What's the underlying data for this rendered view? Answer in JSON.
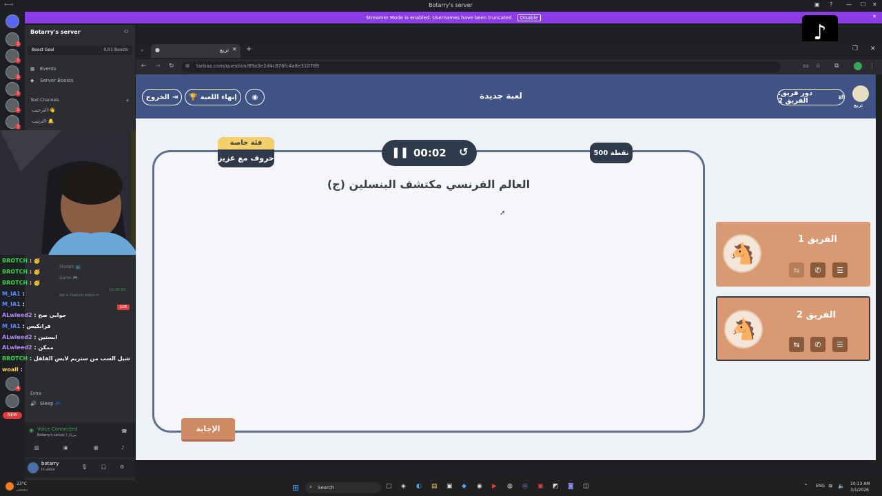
{
  "titlebar": {
    "title": "Botarry's server"
  },
  "banner": {
    "text": "Streamer Mode is enabled. Usernames have been truncated.",
    "button": "Disable"
  },
  "server_panel": {
    "server_name": "Botarry's server",
    "boost_goal": "Boost Goal",
    "boost_count": "0/31 Boosts",
    "items": [
      "Events",
      "Server Boosts"
    ],
    "text_channels_header": "Text Channels",
    "text_channels": [
      "الترحيب-👋",
      "الترتيب-🔔"
    ],
    "channels_lower": [
      "Stream 📺",
      "Game 🎮"
    ],
    "voice_status": "Voice Connected",
    "voice_sub": "Botarry's server / مريال",
    "user_name": "botarry",
    "user_status": "In voice",
    "extra_header": "Extra",
    "sleep_channel": "Sleep 💤",
    "new_badge": "NEW",
    "live_badge": "LIVE",
    "time_small": "13:29:03",
    "set_status": "Set a Channel status ✏"
  },
  "chat": [
    {
      "user": "BROTCH",
      "msg": "🥳",
      "color": "#39d353"
    },
    {
      "user": "BROTCH",
      "msg": "🥳",
      "color": "#39d353"
    },
    {
      "user": "BROTCH",
      "msg": "🥳",
      "color": "#39d353"
    },
    {
      "user": "M_IA1",
      "msg": "",
      "color": "#5b8cff"
    },
    {
      "user": "M_IA1",
      "msg": "",
      "color": "#5b8cff"
    },
    {
      "user": "ALwleed2",
      "msg": "جوابي صح",
      "color": "#b78cff"
    },
    {
      "user": "M_IA1",
      "msg": "فرانكيس",
      "color": "#5b8cff"
    },
    {
      "user": "ALwleed2",
      "msg": "ابستين",
      "color": "#b78cff"
    },
    {
      "user": "ALwleed2",
      "msg": "ممكن",
      "color": "#b78cff"
    },
    {
      "user": "BROTCH",
      "msg": "شيل السب من ستريم لايس الفلفل",
      "color": "#39d353"
    },
    {
      "user": "woall",
      "msg": "",
      "color": "#ffd34d"
    }
  ],
  "browser": {
    "tab_title": "تربع",
    "url": "tarbaa.com/question/69a3e2d4c876fc4a8e310789"
  },
  "game": {
    "logo_text": "تربع",
    "turn_label": "دور فريق: الفريق 2",
    "title": "لعبة جديدة",
    "end_game": "إنهاء اللعبة",
    "exit": "الخروج",
    "timer": "00:02",
    "points": "500 نقطة",
    "category_top": "فئة خاصة",
    "category_bottom": "حروف مع عزيز",
    "question": "العالم الفرنسي مكتشف البنسلين (ج)",
    "answer_button": "الإجابة",
    "teams": [
      {
        "name": "الفريق 1",
        "color": "#d99a73"
      },
      {
        "name": "الفريق 2",
        "color": "#d99a73"
      }
    ]
  },
  "taskbar": {
    "weather_temp": "23°C",
    "weather_desc": "مشمس",
    "search_placeholder": "Search",
    "lang": "ENG",
    "time": "10:13 AM",
    "date": "3/1/2026"
  },
  "colors": {
    "accent": "#3f5384",
    "team_fill": "#d99a73",
    "board_border": "#5c6f91",
    "discord_purple": "#8b3ce6"
  }
}
